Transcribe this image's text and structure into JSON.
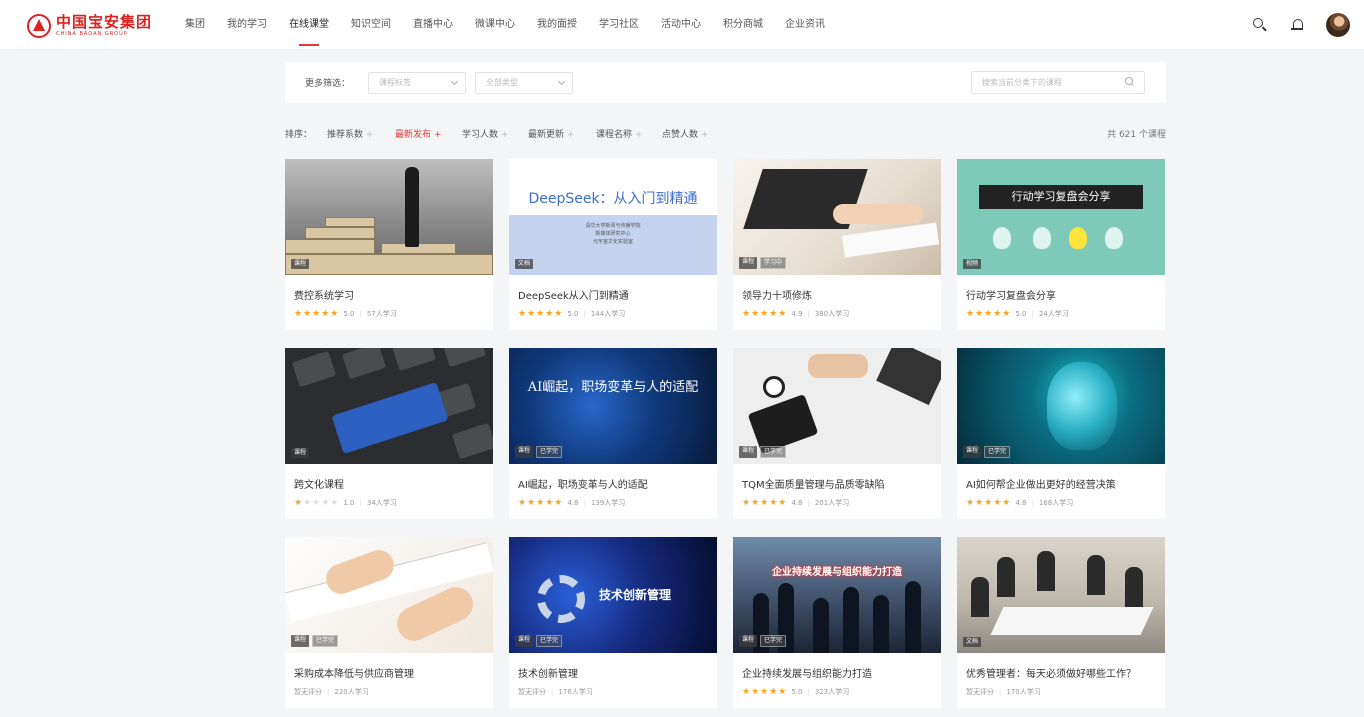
{
  "brand": {
    "name_cn": "中国宝安集团",
    "name_en": "CHINA BAOAN GROUP"
  },
  "nav": [
    {
      "label": "集团"
    },
    {
      "label": "我的学习"
    },
    {
      "label": "在线课堂",
      "active": true
    },
    {
      "label": "知识空间"
    },
    {
      "label": "直播中心"
    },
    {
      "label": "微课中心"
    },
    {
      "label": "我的面授"
    },
    {
      "label": "学习社区"
    },
    {
      "label": "活动中心"
    },
    {
      "label": "积分商城"
    },
    {
      "label": "企业资讯"
    }
  ],
  "filter": {
    "label": "更多筛选：",
    "tags_placeholder": "课程标签",
    "type_placeholder": "全部类型",
    "search_placeholder": "搜索当前分类下的课程"
  },
  "sort": {
    "label": "排序：",
    "items": [
      {
        "label": "推荐系数",
        "arrow": "+"
      },
      {
        "label": "最新发布",
        "arrow": "+",
        "active": true
      },
      {
        "label": "学习人数",
        "arrow": "+"
      },
      {
        "label": "最新更新",
        "arrow": "+"
      },
      {
        "label": "课程名称",
        "arrow": "+"
      },
      {
        "label": "点赞人数",
        "arrow": "+"
      }
    ],
    "total": "共 621 个课程"
  },
  "stars_full": "★★★★★",
  "stars_one": "★",
  "stars_rest": "★★★★",
  "courses": [
    {
      "title": "费控系统学习",
      "tag": "课程",
      "score": "5.0",
      "learners": "57人学习"
    },
    {
      "title": "DeepSeek从入门到精通",
      "tag": "文档",
      "score": "5.0",
      "learners": "144人学习",
      "thumb_title": "DeepSeek：从入门到精通",
      "thumb_lines": [
        "清华大学新闻与传播学院",
        "新媒体研究中心",
        "元宇宙文化实验室"
      ]
    },
    {
      "title": "领导力十项修炼",
      "tag": "课程",
      "tag2": "学习中",
      "score": "4.9",
      "learners": "380人学习"
    },
    {
      "title": "行动学习复盘会分享",
      "tag": "视频",
      "score": "5.0",
      "learners": "24人学习",
      "thumb_title": "行动学习复盘会分享"
    },
    {
      "title": "跨文化课程",
      "tag": "课程",
      "score": "1.0",
      "learners": "34人学习"
    },
    {
      "title": "AI崛起，职场变革与人的适配",
      "tag": "课程",
      "tag2": "已学完",
      "score": "4.8",
      "learners": "139人学习",
      "thumb_title": "AI崛起，职场变革与人的适配"
    },
    {
      "title": "TQM全面质量管理与品质零缺陷",
      "tag": "课程",
      "tag2": "已学完",
      "score": "4.8",
      "learners": "201人学习"
    },
    {
      "title": "AI如何帮企业做出更好的经营决策",
      "tag": "课程",
      "tag2": "已学完",
      "score": "4.8",
      "learners": "168人学习"
    },
    {
      "title": "采购成本降低与供应商管理",
      "tag": "课程",
      "tag2": "已学完",
      "score": "暂无评分",
      "learners": "220人学习"
    },
    {
      "title": "技术创新管理",
      "tag": "课程",
      "tag2": "已学完",
      "score": "暂无评分",
      "learners": "176人学习",
      "thumb_title": "技术创新管理"
    },
    {
      "title": "企业持续发展与组织能力打造",
      "tag": "课程",
      "tag2": "已学完",
      "score": "5.0",
      "learners": "323人学习",
      "thumb_title": "企业持续发展与组织能力打造"
    },
    {
      "title": "优秀管理者：每天必须做好哪些工作？",
      "tag": "文档",
      "score": "暂无评分",
      "learners": "170人学习"
    }
  ]
}
